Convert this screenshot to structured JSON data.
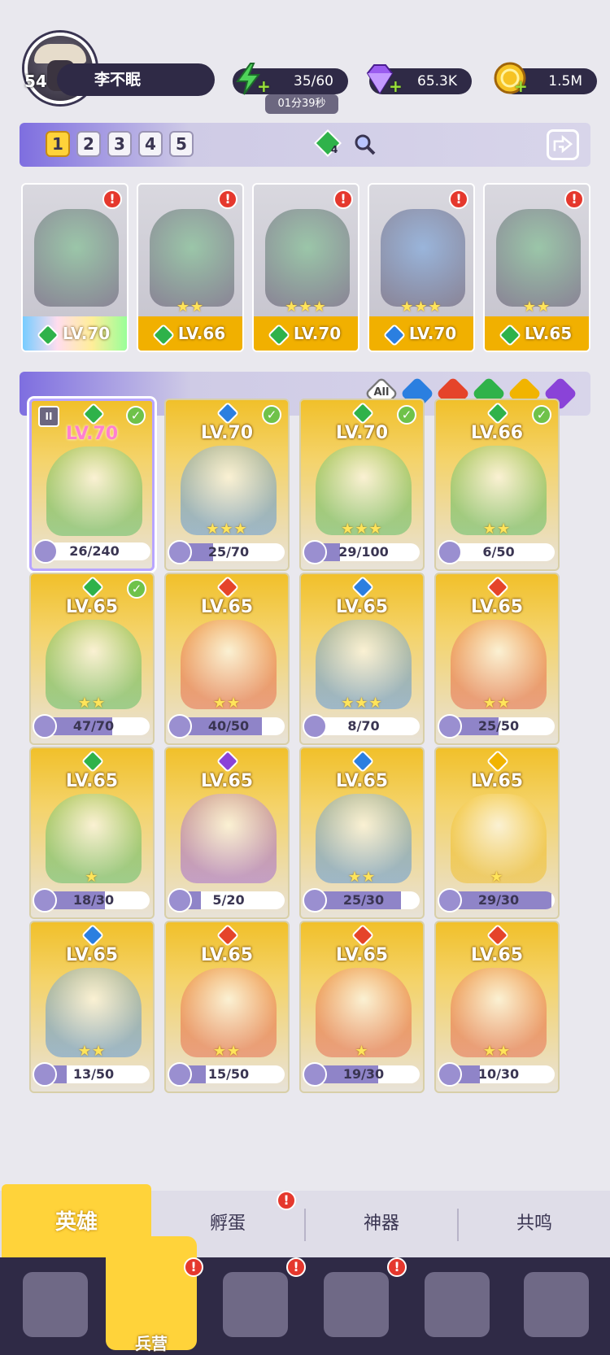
{
  "player": {
    "name": "李不眠",
    "level": "54"
  },
  "resources": {
    "energy": "35/60",
    "energy_timer": "01分39秒",
    "gems": "65.3K",
    "gold": "1.5M"
  },
  "team": {
    "tabs": [
      "1",
      "2",
      "3",
      "4",
      "5"
    ],
    "active_tab": "1",
    "element_count": "4",
    "members": [
      {
        "level": "LV.70",
        "element_color": "#2fb24a",
        "stars": "",
        "alert": true,
        "rainbow": true
      },
      {
        "level": "LV.66",
        "element_color": "#2fb24a",
        "stars": "★★",
        "alert": true
      },
      {
        "level": "LV.70",
        "element_color": "#2fb24a",
        "stars": "★★★",
        "alert": true
      },
      {
        "level": "LV.70",
        "element_color": "#2b7fe0",
        "stars": "★★★",
        "alert": true
      },
      {
        "level": "LV.65",
        "element_color": "#2fb24a",
        "stars": "★★",
        "alert": true
      }
    ]
  },
  "filters": {
    "all_label": "All",
    "elements": [
      {
        "name": "water",
        "color": "#2b7fe0"
      },
      {
        "name": "fire",
        "color": "#e5442a"
      },
      {
        "name": "nature",
        "color": "#2fb24a"
      },
      {
        "name": "light",
        "color": "#f1b400"
      },
      {
        "name": "dark",
        "color": "#8a43d8"
      }
    ]
  },
  "heroes": [
    {
      "level": "LV.70",
      "shards": "26/240",
      "progress": 0.11,
      "element_color": "#2fb24a",
      "owned": true,
      "stars": "",
      "rank": "II",
      "selected": true
    },
    {
      "level": "LV.70",
      "shards": "25/70",
      "progress": 0.36,
      "element_color": "#2b7fe0",
      "owned": true,
      "stars": "★★★"
    },
    {
      "level": "LV.70",
      "shards": "29/100",
      "progress": 0.29,
      "element_color": "#2fb24a",
      "owned": true,
      "stars": "★★★"
    },
    {
      "level": "LV.66",
      "shards": "6/50",
      "progress": 0.12,
      "element_color": "#2fb24a",
      "owned": true,
      "stars": "★★"
    },
    {
      "level": "LV.65",
      "shards": "47/70",
      "progress": 0.67,
      "element_color": "#2fb24a",
      "owned": true,
      "stars": "★★"
    },
    {
      "level": "LV.65",
      "shards": "40/50",
      "progress": 0.8,
      "element_color": "#e5442a",
      "stars": "★★"
    },
    {
      "level": "LV.65",
      "shards": "8/70",
      "progress": 0.11,
      "element_color": "#2b7fe0",
      "stars": "★★★"
    },
    {
      "level": "LV.65",
      "shards": "25/50",
      "progress": 0.5,
      "element_color": "#e5442a",
      "stars": "★★"
    },
    {
      "level": "LV.65",
      "shards": "18/30",
      "progress": 0.6,
      "element_color": "#2fb24a",
      "stars": "★"
    },
    {
      "level": "LV.65",
      "shards": "5/20",
      "progress": 0.25,
      "element_color": "#8a43d8",
      "stars": ""
    },
    {
      "level": "LV.65",
      "shards": "25/30",
      "progress": 0.83,
      "element_color": "#2b7fe0",
      "stars": "★★"
    },
    {
      "level": "LV.65",
      "shards": "29/30",
      "progress": 0.97,
      "element_color": "#f1b400",
      "stars": "★"
    },
    {
      "level": "LV.65",
      "shards": "13/50",
      "progress": 0.26,
      "element_color": "#2b7fe0",
      "stars": "★★"
    },
    {
      "level": "LV.65",
      "shards": "15/50",
      "progress": 0.3,
      "element_color": "#e5442a",
      "stars": "★★"
    },
    {
      "level": "LV.65",
      "shards": "19/30",
      "progress": 0.63,
      "element_color": "#e5442a",
      "stars": "★"
    },
    {
      "level": "LV.65",
      "shards": "10/30",
      "progress": 0.33,
      "element_color": "#e5442a",
      "stars": "★★"
    }
  ],
  "sub_tabs": [
    {
      "label": "英雄",
      "active": true
    },
    {
      "label": "孵蛋",
      "alert": true
    },
    {
      "label": "神器"
    },
    {
      "label": "共鸣"
    }
  ],
  "bottom_nav": [
    {
      "name": "cards",
      "label": ""
    },
    {
      "name": "barracks",
      "label": "兵营",
      "active": true,
      "alert": true
    },
    {
      "name": "map",
      "label": "",
      "alert": true
    },
    {
      "name": "castle",
      "label": "",
      "alert": true
    },
    {
      "name": "mushroom",
      "label": ""
    },
    {
      "name": "banner",
      "label": ""
    }
  ]
}
